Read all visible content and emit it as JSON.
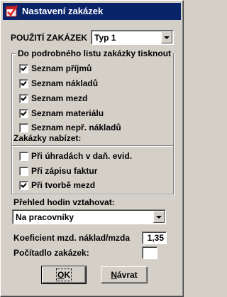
{
  "window": {
    "title": "Nastavení zakázek",
    "app_icon": "red-checkbox-app-icon"
  },
  "usage": {
    "label": "POUŽITÍ ZAKÁZEK",
    "selected": "Typ 1"
  },
  "print_group": {
    "caption": "Do podrobného listu zakázky tisknout",
    "items": [
      {
        "label": "Seznam příjmů",
        "checked": true
      },
      {
        "label": "Seznam nákladů",
        "checked": true
      },
      {
        "label": "Seznam mezd",
        "checked": true
      },
      {
        "label": "Seznam materiálu",
        "checked": true
      },
      {
        "label": "Seznam nepř. nákladů",
        "checked": false
      }
    ]
  },
  "offer_group": {
    "caption": "Zakázky nabízet:",
    "items": [
      {
        "label": "Při úhradách v daň. evid.",
        "checked": false
      },
      {
        "label": "Při zápisu faktur",
        "checked": false
      },
      {
        "label": "Při tvorbě mezd",
        "checked": true
      }
    ]
  },
  "hours": {
    "label": "Přehled hodin vztahovat:",
    "selected": "Na pracovníky"
  },
  "coefficient": {
    "label": "Koeficient mzd. náklad/mzda",
    "value": "1,35"
  },
  "counter": {
    "label": "Počítadlo zakázek:",
    "value": ""
  },
  "buttons": {
    "ok_label": "OK",
    "ok_mnemonic": "O",
    "ok_rest": "K",
    "back_label": "Návrat",
    "back_mnemonic": "N",
    "back_rest": "ávrat"
  },
  "colors": {
    "titlebar": "#0a246a",
    "window_bg": "#d4d0c8",
    "field_bg": "#ffffff"
  }
}
